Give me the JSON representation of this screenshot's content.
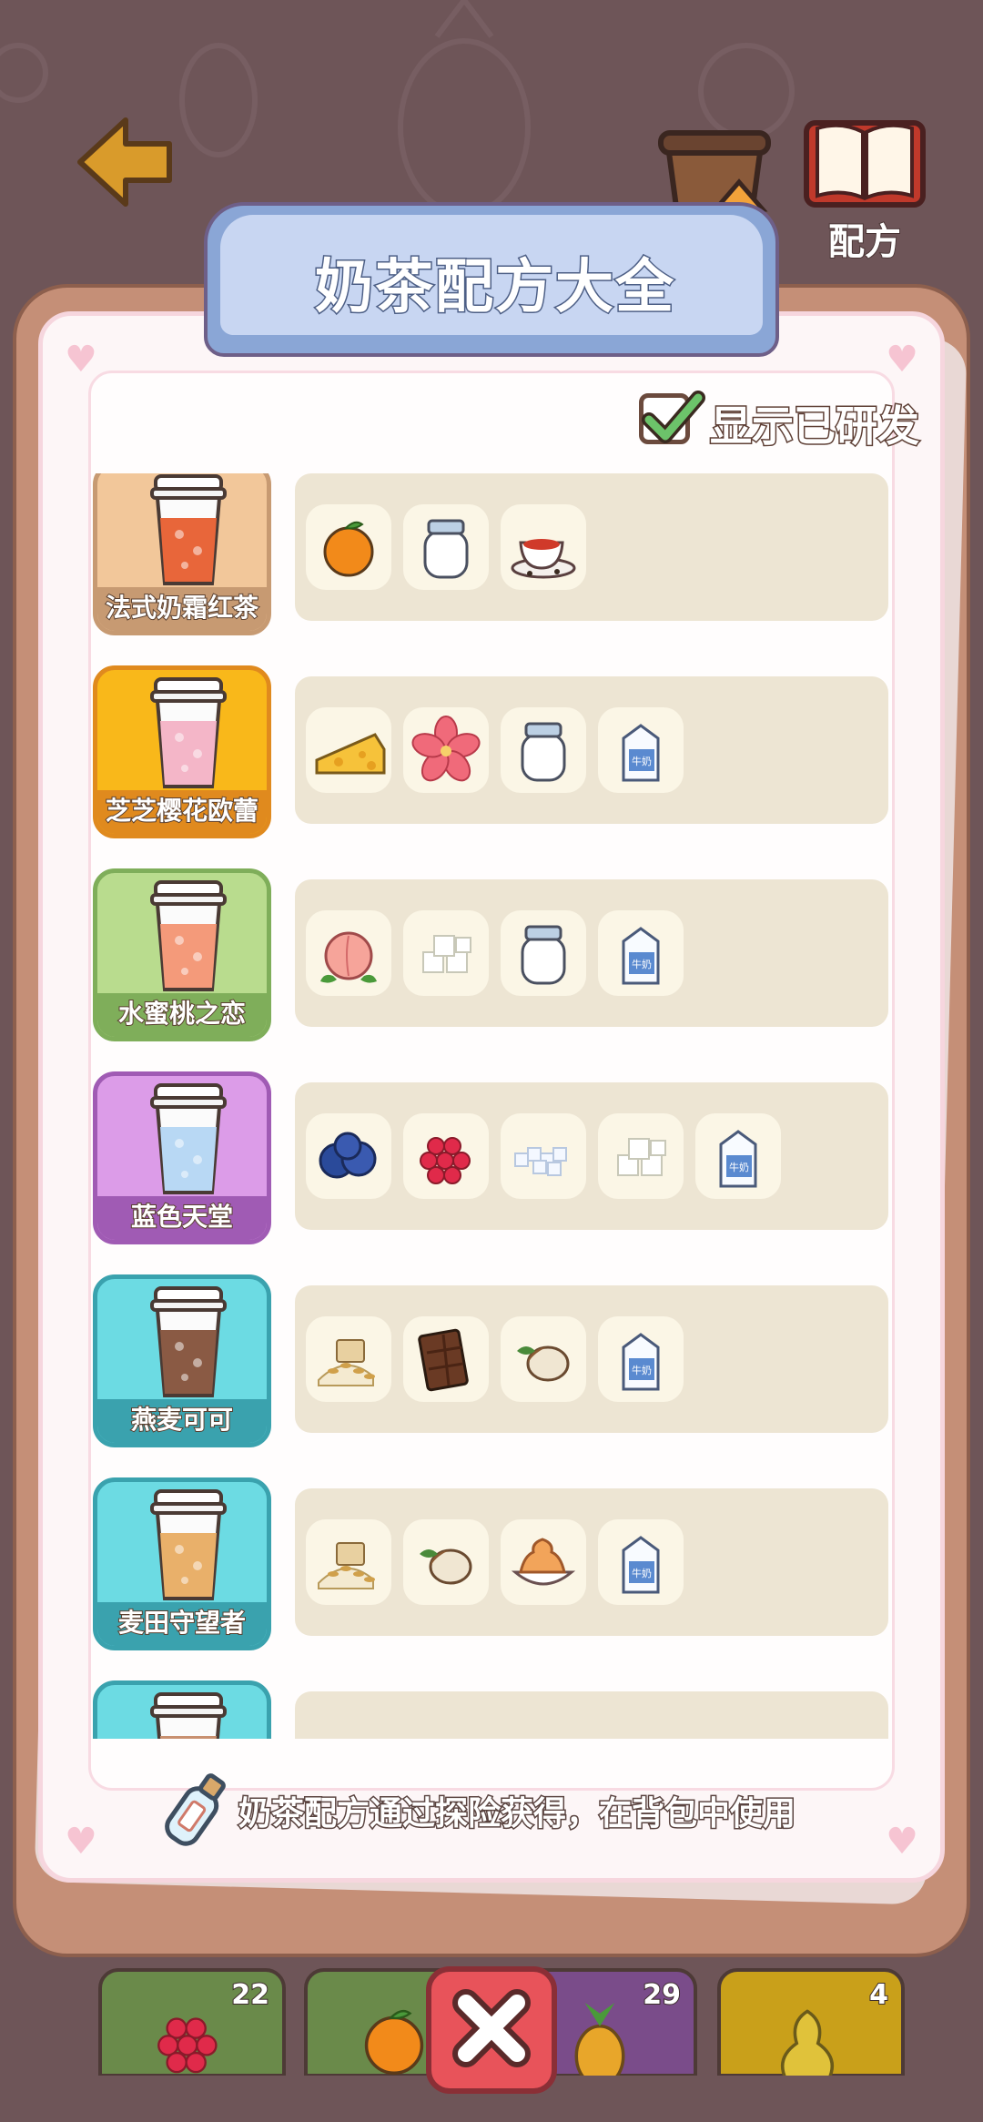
{
  "title": "奶茶配方大全",
  "show_researched": {
    "label": "显示已研发",
    "checked": true
  },
  "top_nav": {
    "recipe_label": "配方"
  },
  "recipes": [
    {
      "name": "法式奶霜红茶",
      "card_color": "#f2c79a",
      "card_border": "#c79a72",
      "drink_color": "#e8663a",
      "ingredients": [
        "orange-icon",
        "jar-icon",
        "tea-cup-icon"
      ]
    },
    {
      "name": "芝芝樱花欧蕾",
      "card_color": "#f9b81a",
      "card_border": "#e08a1e",
      "drink_color": "#f4b6c8",
      "ingredients": [
        "cheese-icon",
        "sakura-icon",
        "jar-icon",
        "milk-carton-icon"
      ]
    },
    {
      "name": "水蜜桃之恋",
      "card_color": "#b9dc8e",
      "card_border": "#7fae5a",
      "drink_color": "#f49a7a",
      "ingredients": [
        "peach-icon",
        "sugar-cubes-icon",
        "jar-icon",
        "milk-carton-icon"
      ]
    },
    {
      "name": "蓝色天堂",
      "card_color": "#dc9ce8",
      "card_border": "#a05bb4",
      "drink_color": "#b8d8f4",
      "ingredients": [
        "blueberry-icon",
        "raspberry-icon",
        "ice-cubes-icon",
        "sugar-cubes-icon",
        "milk-carton-icon"
      ]
    },
    {
      "name": "燕麦可可",
      "card_color": "#6cdbe3",
      "card_border": "#3aa2ae",
      "drink_color": "#8a5a44",
      "ingredients": [
        "oat-icon",
        "chocolate-icon",
        "hazelnut-icon",
        "milk-carton-icon"
      ]
    },
    {
      "name": "麦田守望者",
      "card_color": "#6cdbe3",
      "card_border": "#3aa2ae",
      "drink_color": "#e9b06a",
      "ingredients": [
        "oat-icon",
        "hazelnut-icon",
        "caramel-cream-icon",
        "milk-carton-icon"
      ]
    },
    {
      "name": "",
      "card_color": "#6cdbe3",
      "card_border": "#3aa2ae",
      "drink_color": "#c89070",
      "ingredients": []
    }
  ],
  "footer_note": "奶茶配方通过探险获得，在背包中使用",
  "fruit_tray": [
    {
      "icon": "raspberry-icon",
      "count": "22",
      "color": "#6a8a4a"
    },
    {
      "icon": "orange-icon",
      "count": "",
      "color": "#6a8a4a"
    },
    {
      "icon": "pineapple-icon",
      "count": "29",
      "color": "#7a4c8a"
    },
    {
      "icon": "pear-icon",
      "count": "4",
      "color": "#c9a01a"
    }
  ]
}
